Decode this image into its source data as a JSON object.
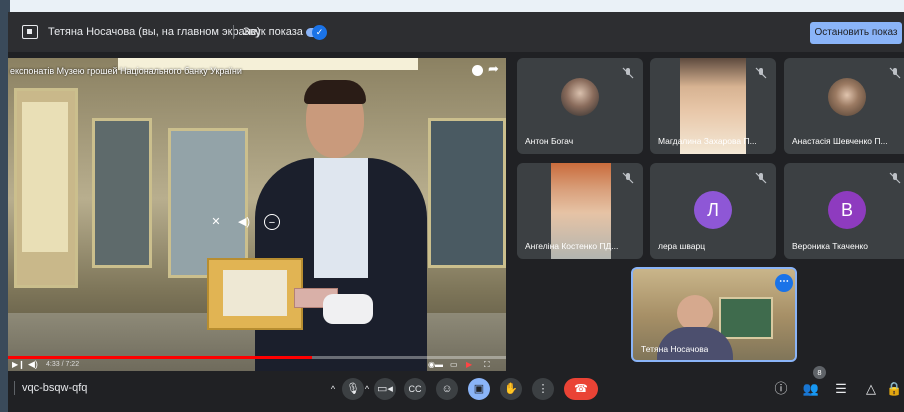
{
  "present_bar": {
    "presenter_name": "Тетяна Носачова (вы, на главном экране)",
    "sound_label": "Звук показа",
    "sound_enabled": true,
    "stop_button_label": "Остановить показ"
  },
  "shared_video": {
    "title": "експонатів Музею грошей Національного банку України",
    "time": "4:33 / 7:22",
    "progress_fraction": 0.61
  },
  "participants": [
    {
      "name": "Антон Богач",
      "type": "avatar-photo",
      "muted": true
    },
    {
      "name": "Магдалина Захарова П...",
      "type": "camera",
      "muted": true
    },
    {
      "name": "Анастасія Шевченко П...",
      "type": "avatar-photo",
      "muted": true
    },
    {
      "name": "Ангеліна Костенко ПД...",
      "type": "camera",
      "muted": true
    },
    {
      "name": "лера шварц",
      "type": "letter",
      "letter": "Л",
      "color": "#8e57d6",
      "muted": true
    },
    {
      "name": "Вероника Ткаченко",
      "type": "letter",
      "letter": "В",
      "color": "#8e3bbf",
      "muted": true
    }
  ],
  "self_view": {
    "name": "Тетяна Носачова"
  },
  "bottom_bar": {
    "meeting_code": "vqc-bsqw-qfq",
    "people_count": "8"
  },
  "icons": {
    "present": "present-screen-icon",
    "mic": "mic-icon",
    "camera": "camera-icon",
    "captions": "captions-icon",
    "emoji": "emoji-icon",
    "present_now": "present-now-icon",
    "hand": "raise-hand-icon",
    "more": "more-options-icon",
    "end": "end-call-icon",
    "info": "info-icon",
    "people": "people-icon",
    "chat": "chat-icon",
    "activities": "activities-icon"
  },
  "colors": {
    "accent": "#8ab4f8",
    "end_call": "#ea4335",
    "bg": "#202124",
    "tile": "#3c4043"
  }
}
